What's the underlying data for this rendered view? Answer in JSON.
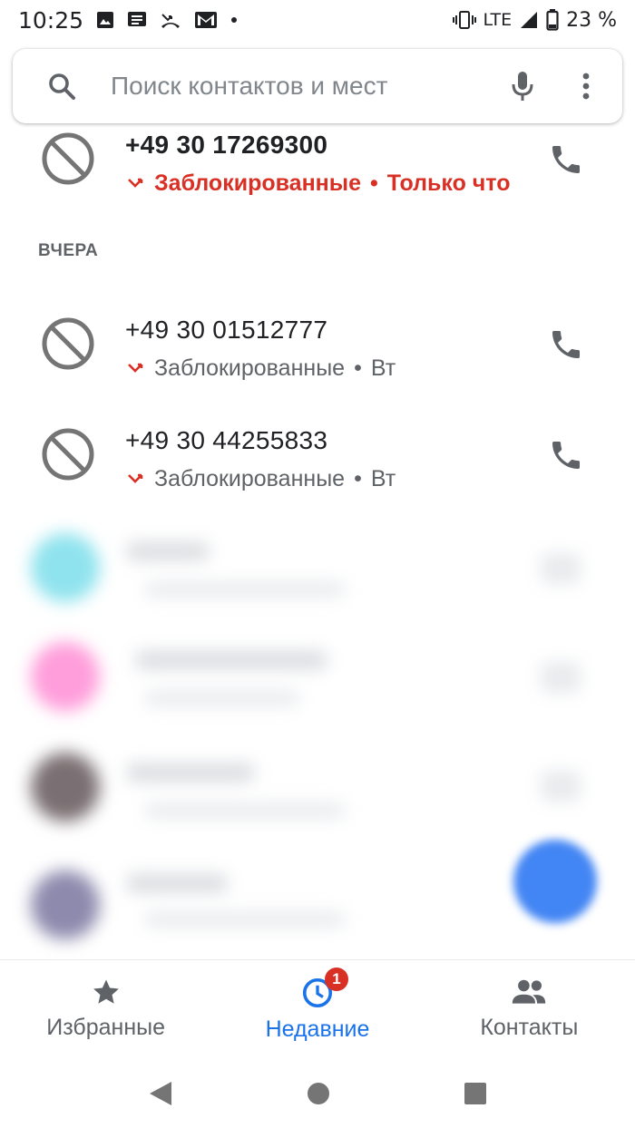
{
  "status_bar": {
    "time": "10:25",
    "network": "LTE",
    "battery": "23 %",
    "notification_icons": [
      "image-icon",
      "message-icon",
      "missed-call-icon",
      "gmail-icon",
      "dot-icon"
    ]
  },
  "search": {
    "placeholder": "Поиск контактов и мест"
  },
  "calls_today": [
    {
      "number": "+49 30 17269300",
      "status": "Заблокированные",
      "separator": "•",
      "time": "Только что",
      "highlight": true
    }
  ],
  "section_yesterday": "ВЧЕРА",
  "calls_yesterday": [
    {
      "number": "+49 30 01512777",
      "status": "Заблокированные",
      "separator": "•",
      "time": "Вт"
    },
    {
      "number": "+49 30 44255833",
      "status": "Заблокированные",
      "separator": "•",
      "time": "Вт"
    }
  ],
  "bottom_nav": {
    "favorites": "Избранные",
    "recent": "Недавние",
    "recent_badge": "1",
    "contacts": "Контакты",
    "active": "recent"
  },
  "colors": {
    "accent": "#1a73e8",
    "missed_red": "#d93025",
    "fab_blue": "#4285f4"
  }
}
